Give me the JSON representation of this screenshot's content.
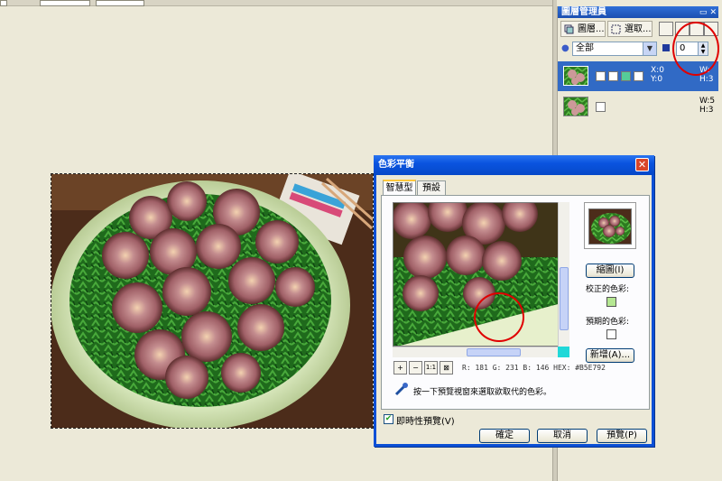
{
  "layer_manager": {
    "title": "圖層管理員",
    "btn_layer": "圖層...",
    "btn_select": "選取...",
    "filter_value": "全部",
    "opacity_value": "0",
    "layers": [
      {
        "x": "X:0",
        "y": "Y:0",
        "w": "W:",
        "h": "H:3"
      },
      {
        "w": "W:5",
        "h": "H:3"
      }
    ]
  },
  "dialog": {
    "title": "色彩平衡",
    "close_glyph": "✕",
    "tabs": [
      "智慧型",
      "預設"
    ],
    "readout": "R: 181   G: 231   B: 146   HEX: #B5E792",
    "hint": "按一下預覽視窗來選取欲取代的色彩。",
    "zoom_labels": [
      "+",
      "−",
      "1:1",
      "⊠"
    ],
    "reset_button": "縮圖(I)",
    "corrected_label": "校正的色彩:",
    "corrected_color": "#b5e792",
    "expected_label": "預期的色彩:",
    "expected_color": "#ffffff",
    "new_button": "新增(A)...",
    "live_preview_label": "即時性預覽(V)",
    "live_preview_checked": "✔",
    "ok_button": "確定",
    "cancel_button": "取消",
    "preview_button": "預覽(P)"
  },
  "colors": {
    "titlebar": "#0a54e0",
    "selection": "#316ac5",
    "annotation": "#e00000"
  }
}
